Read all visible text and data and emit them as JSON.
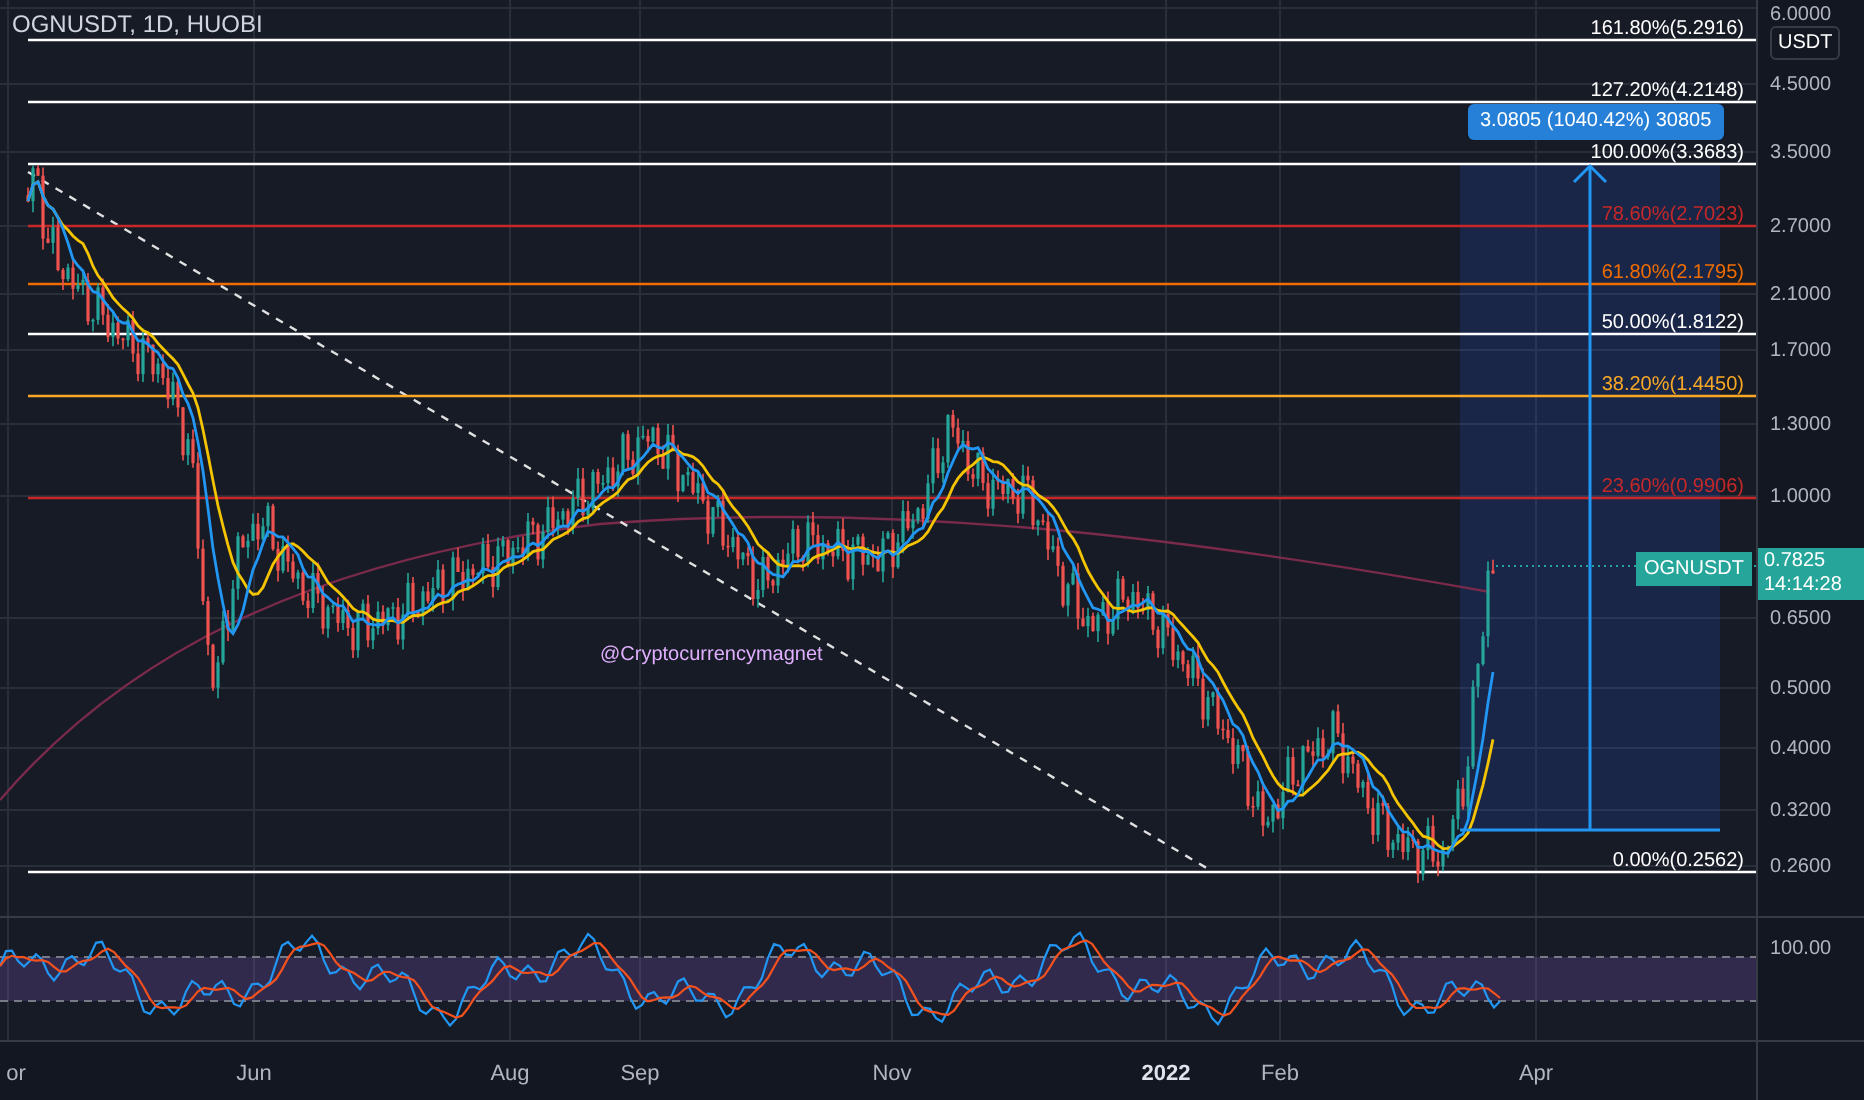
{
  "chart": {
    "title": "OGNUSDT, 1D, HUOBI",
    "annotation": "@Cryptocurrencymagnet",
    "fib_levels": [
      {
        "label": "161.80%(5.2916)",
        "color": "#ffffff"
      },
      {
        "label": "127.20%(4.2148)",
        "color": "#ffffff"
      },
      {
        "label": "100.00%(3.3683)",
        "color": "#ffffff"
      },
      {
        "label": "78.60%(2.7023)",
        "color": "#c62828"
      },
      {
        "label": "61.80%(2.1795)",
        "color": "#ef6c00"
      },
      {
        "label": "50.00%(1.8122)",
        "color": "#ffffff"
      },
      {
        "label": "38.20%(1.4450)",
        "color": "#f9a825"
      },
      {
        "label": "23.60%(0.9906)",
        "color": "#c62828"
      },
      {
        "label": "0.00%(0.2562)",
        "color": "#ffffff"
      }
    ],
    "measure": {
      "label": "3.0805 (1040.42%) 30805"
    },
    "symbol_tag": "OGNUSDT"
  },
  "price_axis": {
    "ticks": [
      "6.0000",
      "4.5000",
      "3.5000",
      "2.7000",
      "2.1000",
      "1.7000",
      "1.3000",
      "1.0000",
      "0.6500",
      "0.5000",
      "0.4000",
      "0.3200",
      "0.2600"
    ],
    "currency": "USDT",
    "last_price": "0.7825",
    "countdown": "14:14:28"
  },
  "rsi": {
    "axis_label": "100.00"
  },
  "time_axis": {
    "labels": [
      {
        "text": "or",
        "bold": false
      },
      {
        "text": "Jun",
        "bold": false
      },
      {
        "text": "Aug",
        "bold": false
      },
      {
        "text": "Sep",
        "bold": false
      },
      {
        "text": "Nov",
        "bold": false
      },
      {
        "text": "2022",
        "bold": true
      },
      {
        "text": "Feb",
        "bold": false
      },
      {
        "text": "Apr",
        "bold": false
      }
    ]
  }
}
